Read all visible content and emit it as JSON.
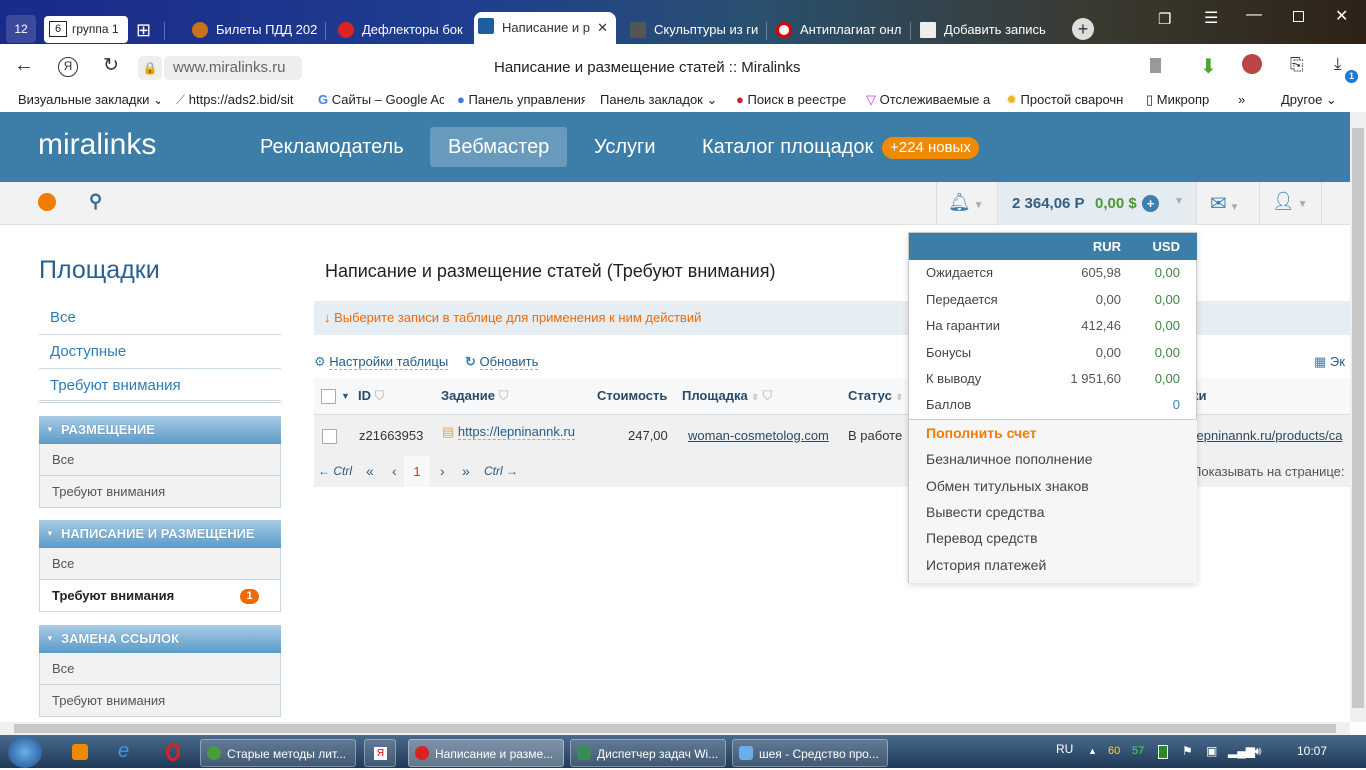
{
  "browser": {
    "group": {
      "count": "12",
      "tab_count": "6",
      "label": "группа 1"
    },
    "tabs": [
      {
        "title": "Билеты ПДД 202",
        "color": "#c33"
      },
      {
        "title": "Дефлекторы бок",
        "color": "#d22"
      },
      {
        "title": "Написание и р",
        "color": "#1a5fa0",
        "active": true
      },
      {
        "title": "Скульптуры из ги",
        "color": "#666"
      },
      {
        "title": "Антиплагиат онл",
        "color": "#d00"
      },
      {
        "title": "Добавить запись",
        "color": "#b99"
      }
    ],
    "url": "www.miralinks.ru",
    "page_title": "Написание и размещение статей :: Miralinks",
    "download_badge": "1",
    "bookmarks": [
      "Визуальные закладки",
      "https://ads2.bid/sit",
      "Сайты – Google Ac",
      "Панель управления",
      "Панель закладок",
      "Поиск в реестре",
      "Отслеживаемые а",
      "Простой сварочн",
      "Микропр"
    ],
    "bookmarks_more": "»",
    "bookmarks_other": "Другое"
  },
  "site": {
    "logo": "miralinks",
    "nav": [
      "Рекламодатель",
      "Вебмастер",
      "Услуги",
      "Каталог площадок"
    ],
    "nav_active": "Вебмастер",
    "catalog_badge": "+224 новых",
    "balance_rub": "2 364,06 Р",
    "balance_usd": "0,00 $"
  },
  "sidebar": {
    "title": "Площадки",
    "links": [
      "Все",
      "Доступные",
      "Требуют внимания"
    ],
    "sections": [
      {
        "title": "РАЗМЕЩЕНИЕ",
        "items": [
          "Все",
          "Требуют внимания"
        ]
      },
      {
        "title": "НАПИСАНИЕ И РАЗМЕЩЕНИЕ",
        "items": [
          "Все",
          "Требуют внимания"
        ],
        "badge": "1"
      },
      {
        "title": "ЗАМЕНА ССЫЛОК",
        "items": [
          "Все",
          "Требуют внимания"
        ]
      }
    ]
  },
  "main": {
    "title": "Написание и размещение статей (Требуют внимания)",
    "hint": "Выберите записи в таблице для применения к ним действий",
    "table_settings": "Настройки таблицы",
    "refresh": "Обновить",
    "export": "Эк",
    "columns": [
      "ID",
      "Задание",
      "Стоимость",
      "Площадка",
      "Статус",
      "ки"
    ],
    "rows": [
      {
        "id": "z21663953",
        "task": "https://lepninannk.ru",
        "price": "247,00",
        "site": "woman-cosmetolog.com",
        "status": "В работе",
        "link": "/lepninannk.ru/products/ca"
      }
    ],
    "pager": {
      "prev_ctrl": "← Ctrl",
      "first": "«",
      "prev": "‹",
      "page": "1",
      "next": "›",
      "last": "»",
      "next_ctrl": "Ctrl →",
      "per_page": "Показывать на странице:"
    }
  },
  "balance_dropdown": {
    "headers": [
      "RUR",
      "USD"
    ],
    "rows": [
      {
        "label": "Ожидается",
        "rur": "605,98",
        "usd": "0,00"
      },
      {
        "label": "Передается",
        "rur": "0,00",
        "usd": "0,00"
      },
      {
        "label": "На гарантии",
        "rur": "412,46",
        "usd": "0,00"
      },
      {
        "label": "Бонусы",
        "rur": "0,00",
        "usd": "0,00"
      },
      {
        "label": "К выводу",
        "rur": "1 951,60",
        "usd": "0,00"
      },
      {
        "label": "Баллов",
        "rur": "",
        "usd": "0"
      }
    ],
    "topup": "Пополнить счет",
    "actions": [
      "Безналичное пополнение",
      "Обмен титульных знаков",
      "Вывести средства",
      "Перевод средств",
      "История платежей"
    ]
  },
  "taskbar": {
    "tasks": [
      "Старые методы лит...",
      "Написание и разме...",
      "Диспетчер задач Wi...",
      "шея - Средство про..."
    ],
    "lang": "RU",
    "temp1": "60",
    "temp2": "57",
    "clock": "10:07"
  },
  "colors": {
    "brand": "#3d7ea8",
    "accent": "#f07c00",
    "usd": "#4a9a30"
  }
}
